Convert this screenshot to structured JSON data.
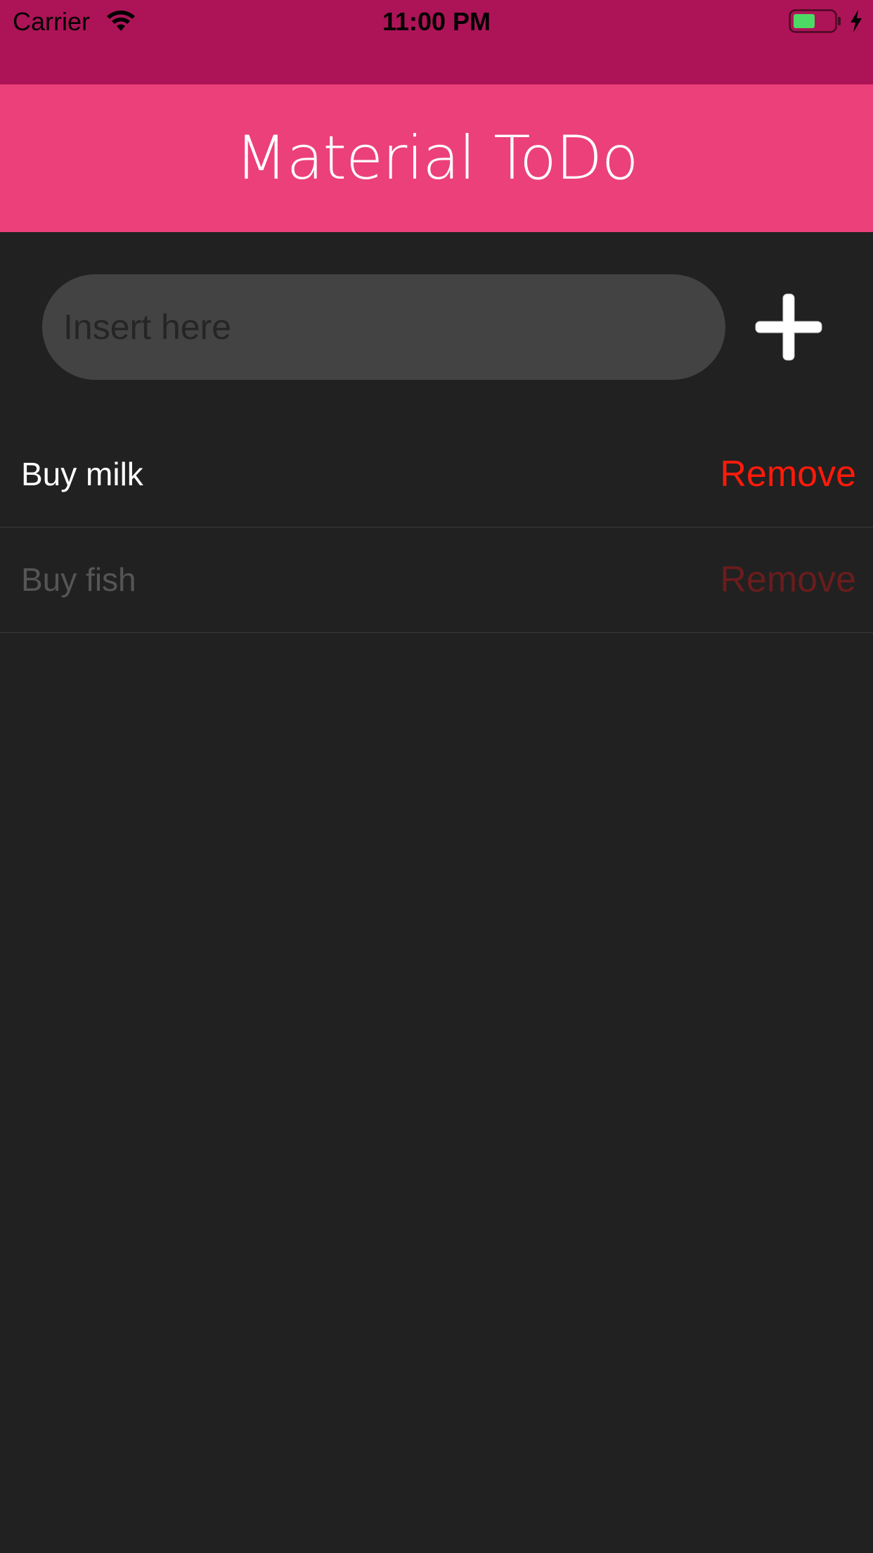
{
  "status_bar": {
    "carrier": "Carrier",
    "time": "11:00 PM",
    "wifi_icon": "wifi-icon",
    "battery_icon": "battery-icon",
    "charging_icon": "charging-bolt-icon",
    "background_color": "#ad1457"
  },
  "app_bar": {
    "title": "Material ToDo",
    "background_color": "#ec407a"
  },
  "composer": {
    "value": "",
    "placeholder": "Insert here",
    "add_icon": "plus-icon"
  },
  "todos": [
    {
      "label": "Buy milk",
      "remove_label": "Remove",
      "completed": false
    },
    {
      "label": "Buy fish",
      "remove_label": "Remove",
      "completed": true
    }
  ],
  "colors": {
    "background": "#212121",
    "input_background": "#434343",
    "remove_active": "#ff1a0a",
    "remove_done": "#6a1c1c"
  }
}
